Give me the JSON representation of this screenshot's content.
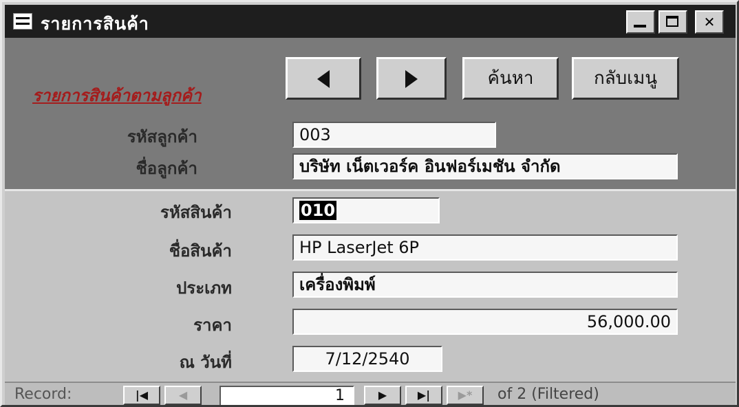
{
  "window": {
    "title": "รายการสินค้า"
  },
  "header": {
    "heading": "รายการสินค้าตามลูกค้า",
    "buttons": {
      "search": "ค้นหา",
      "menu": "กลับเมนู"
    },
    "fields": [
      {
        "label": "รหัสลูกค้า",
        "value": "003"
      },
      {
        "label": "ชื่อลูกค้า",
        "value": "บริษัท เน็ตเวอร์ค อินฟอร์เมชัน จำกัด"
      }
    ]
  },
  "detail": {
    "fields": [
      {
        "label": "รหัสสินค้า",
        "value": "010"
      },
      {
        "label": "ชื่อสินค้า",
        "value": "HP LaserJet 6P"
      },
      {
        "label": "ประเภท",
        "value": "เครื่องพิมพ์"
      },
      {
        "label": "ราคา",
        "value": "56,000.00"
      },
      {
        "label": "ณ วันที่",
        "value": "7/12/2540"
      }
    ]
  },
  "record_nav": {
    "label": "Record:",
    "current": "1",
    "of_text": "of  2 (Filtered)"
  }
}
